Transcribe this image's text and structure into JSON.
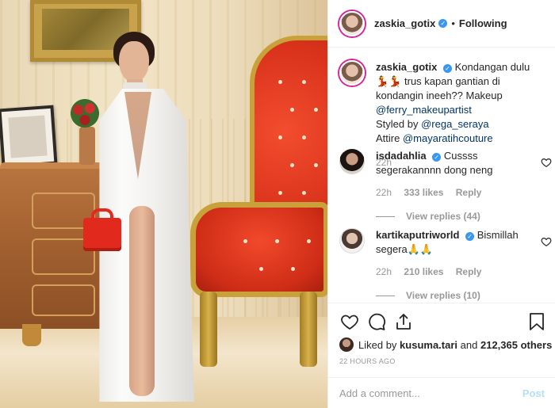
{
  "header": {
    "username": "zaskia_gotix",
    "separator": "•",
    "follow_status": "Following"
  },
  "caption": {
    "username": "zaskia_gotix",
    "text_1": "Kondangan dulu 💃💃",
    "text_2": "trus kapan gantian di kondangin ineeh?? Makeup",
    "mention_makeup": "@ferry_makeupartist",
    "styled_prefix": "Styled by",
    "mention_styled": "@rega_seraya",
    "attire_prefix": "Attire",
    "mention_attire": "@mayaratihcouture",
    "time": "22h"
  },
  "comments": [
    {
      "username": "isdadahlia",
      "text": "Cussss segerakannnn dong neng",
      "time": "22h",
      "likes": "333 likes",
      "reply": "Reply",
      "view_replies": "View replies (44)"
    },
    {
      "username": "kartikaputriworld",
      "text": "Bismillah segera🙏🙏",
      "time": "22h",
      "likes": "210 likes",
      "reply": "Reply",
      "view_replies": "View replies (10)"
    }
  ],
  "actions": {
    "liked_prefix": "Liked by",
    "liked_user": "kusuma.tari",
    "liked_and": "and",
    "liked_count": "212,365 others",
    "timestamp": "22 HOURS AGO"
  },
  "add_comment": {
    "placeholder": "Add a comment...",
    "post_label": "Post"
  },
  "icons": [
    "heart-icon",
    "comment-icon",
    "share-icon",
    "bookmark-icon",
    "verified-icon"
  ]
}
